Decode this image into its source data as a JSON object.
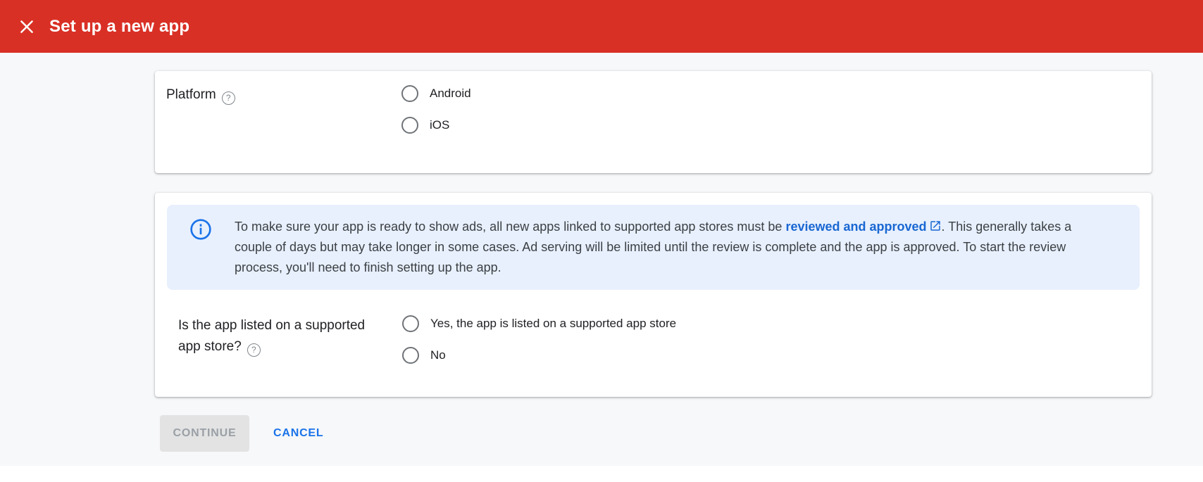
{
  "header": {
    "title": "Set up a new app"
  },
  "platform": {
    "label": "Platform",
    "help_icon": "question-mark-circle",
    "options": [
      {
        "label": "Android",
        "selected": false
      },
      {
        "label": "iOS",
        "selected": false
      }
    ]
  },
  "notice": {
    "icon": "info-circle",
    "before_link": "To make sure your app is ready to show ads, all new apps linked to supported app stores must be ",
    "link": "reviewed and approved",
    "after_link": ". This generally takes a couple of days but may take longer in some cases. Ad serving will be limited until the review is complete and the app is approved. To start the review process, you'll need to finish setting up the app."
  },
  "store_question": {
    "label": "Is the app listed on a supported app store?",
    "help_icon": "question-mark-circle",
    "options": [
      {
        "label": "Yes, the app is listed on a supported app store",
        "selected": false
      },
      {
        "label": "No",
        "selected": false
      }
    ]
  },
  "actions": {
    "continue_label": "CONTINUE",
    "cancel_label": "CANCEL",
    "continue_disabled": true
  },
  "colors": {
    "header_background": "#D93025",
    "banner_background": "#E8F0FE",
    "link_blue": "#1967D2",
    "accent_blue": "#1A73E8"
  }
}
